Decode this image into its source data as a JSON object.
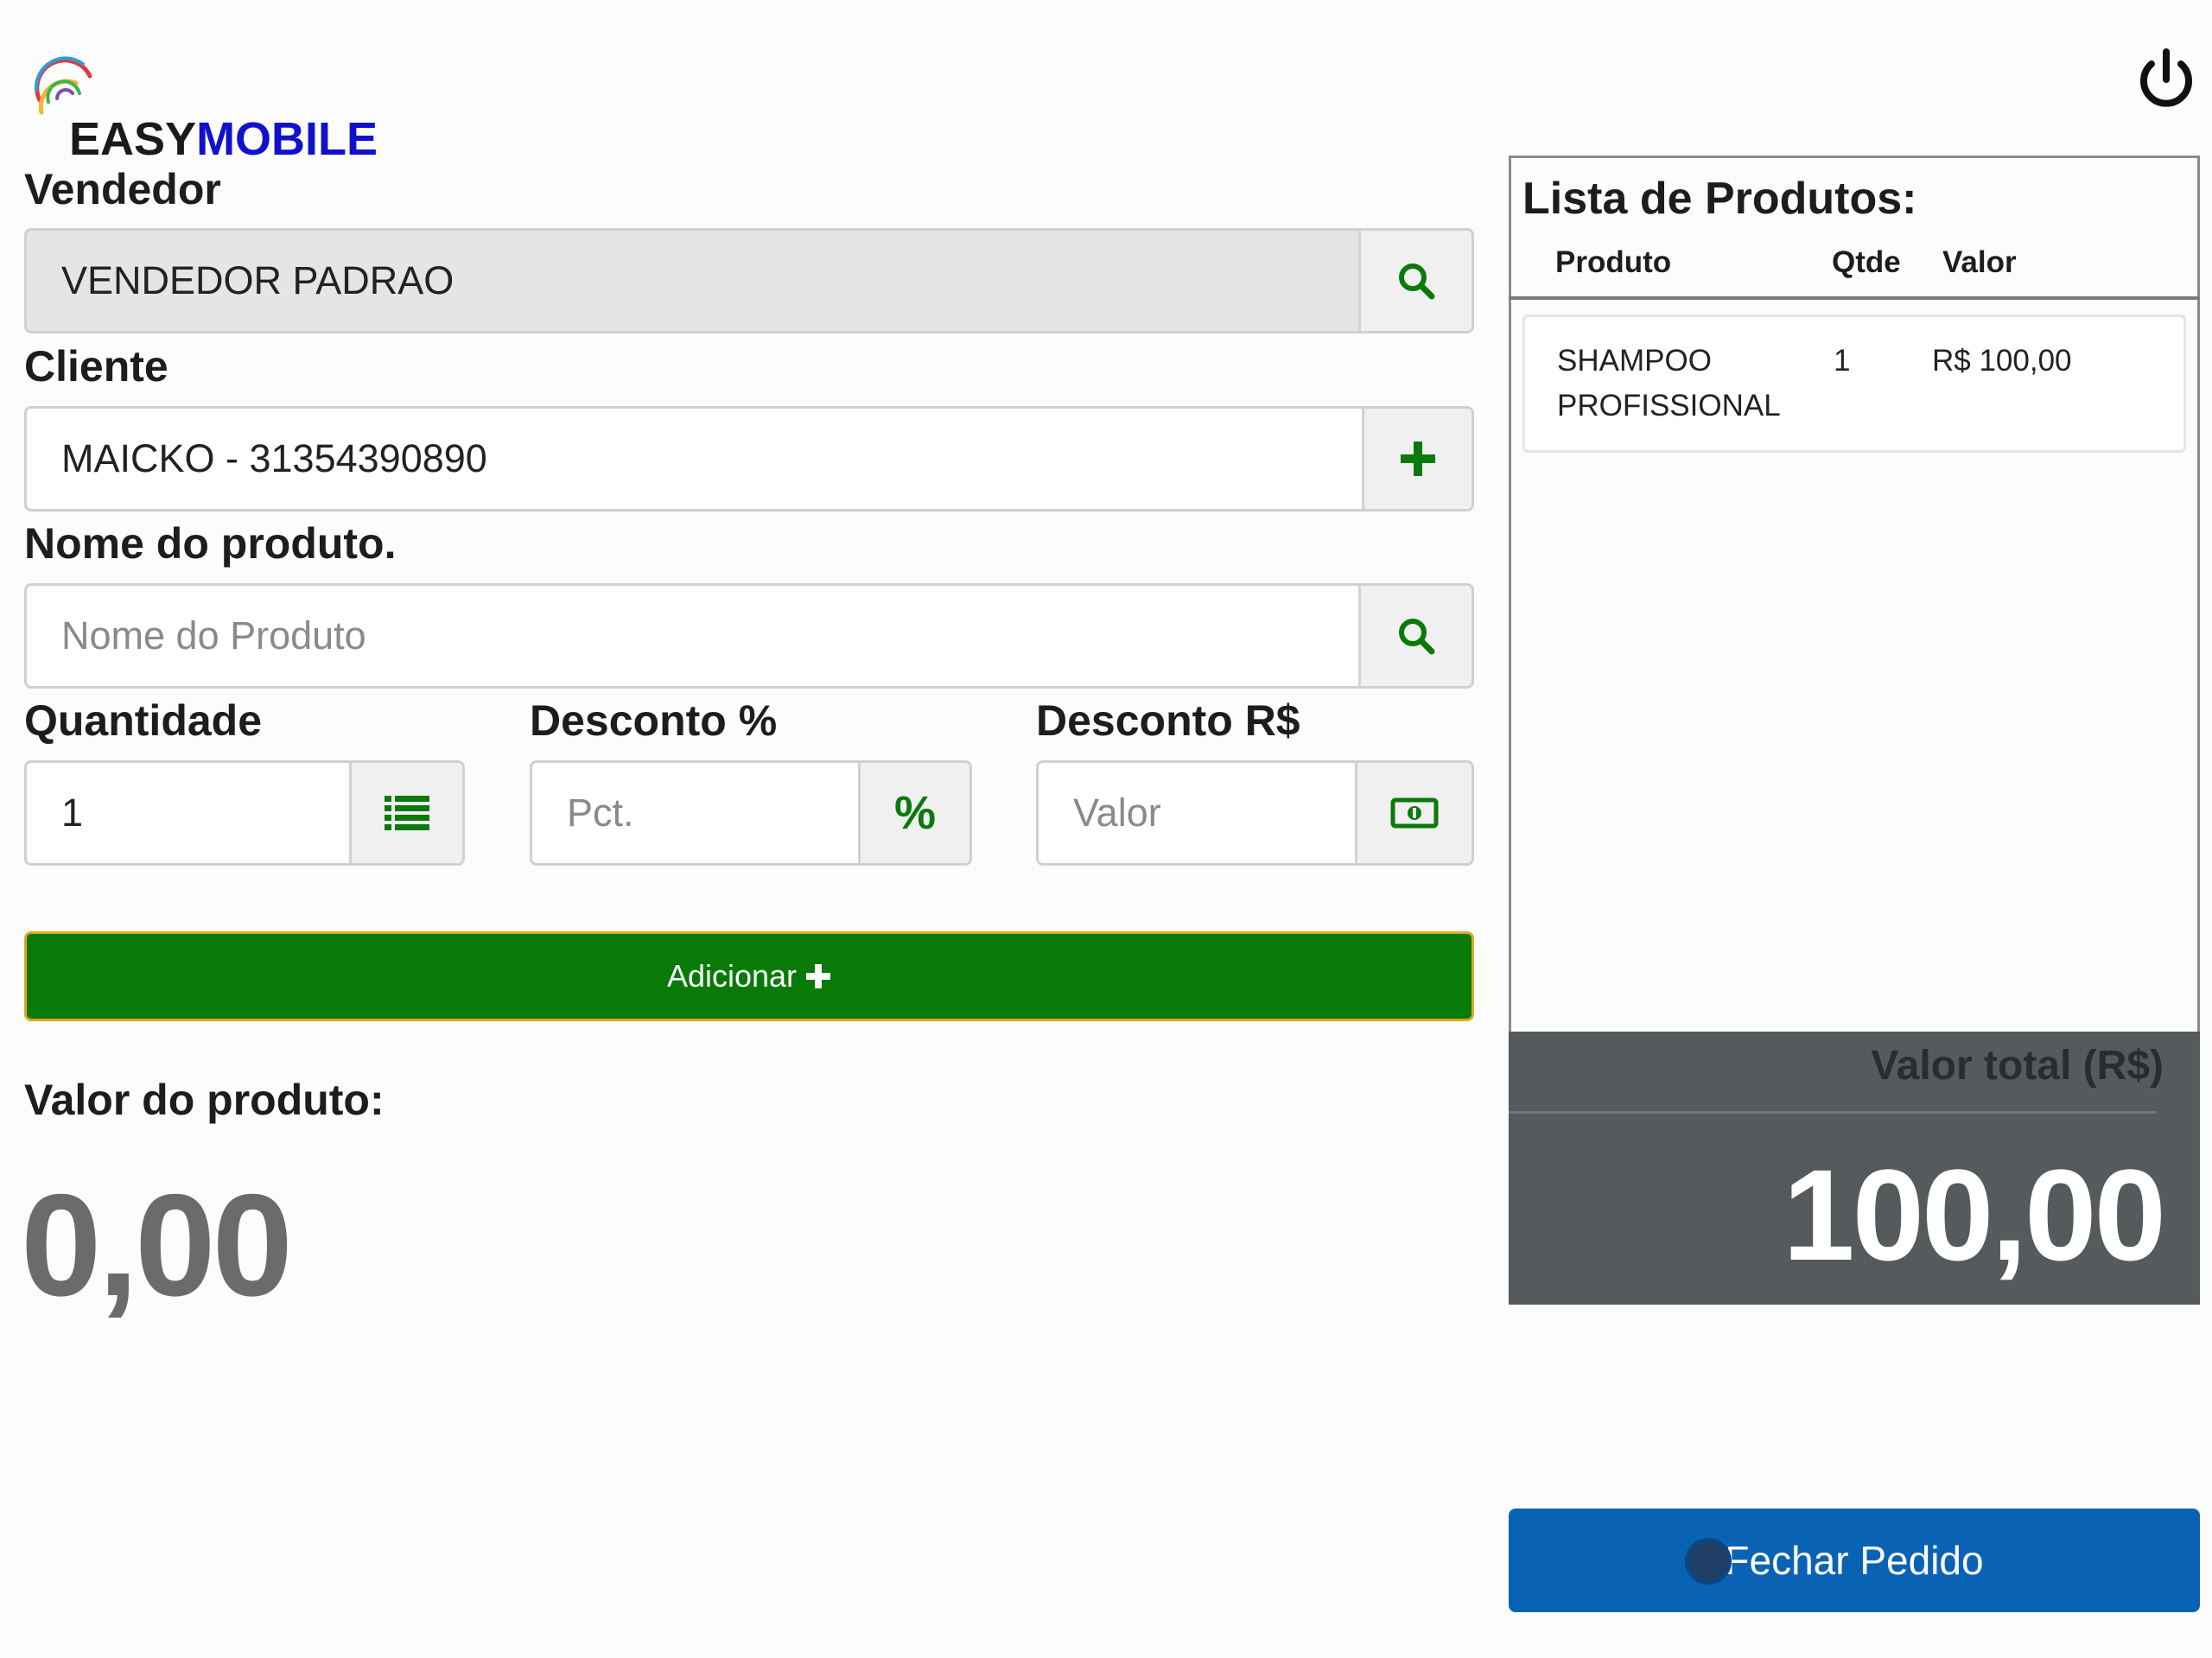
{
  "brand": {
    "easy": "EASY",
    "mobile": "MOBILE"
  },
  "icons": {
    "logo": "swirl-logo-icon",
    "power": "power-icon",
    "search": "search-icon",
    "plus": "plus-icon",
    "list": "list-icon",
    "percent": "percent-icon",
    "money": "money-icon"
  },
  "colors": {
    "green": "#077a07",
    "add_border": "#e2a51e",
    "blue": "#0a62b4",
    "brand_blue": "#1111cc",
    "total_bg": "#555a5c"
  },
  "form": {
    "vendedor": {
      "label": "Vendedor",
      "value": "VENDEDOR PADRAO"
    },
    "cliente": {
      "label": "Cliente",
      "value": "MAICKO - 31354390890"
    },
    "produto": {
      "label": "Nome do produto.",
      "placeholder": "Nome do Produto"
    },
    "quantidade": {
      "label": "Quantidade",
      "value": "1"
    },
    "desconto_pct": {
      "label": "Desconto %",
      "placeholder": "Pct.",
      "icon_text": "%"
    },
    "desconto_rs": {
      "label": "Desconto R$",
      "placeholder": "Valor"
    },
    "add_button": "Adicionar",
    "product_value_label": "Valor do produto:",
    "product_value": "0,00"
  },
  "list": {
    "title": "Lista de Produtos:",
    "headers": {
      "produto": "Produto",
      "qtde": "Qtde",
      "valor": "Valor"
    },
    "items": [
      {
        "produto_l1": "SHAMPOO",
        "produto_l2": "PROFISSIONAL",
        "qtde": "1",
        "valor": "R$ 100,00"
      }
    ]
  },
  "total": {
    "label": "Valor total (R$)",
    "value": "100,00"
  },
  "close_button": "Fechar Pedido"
}
